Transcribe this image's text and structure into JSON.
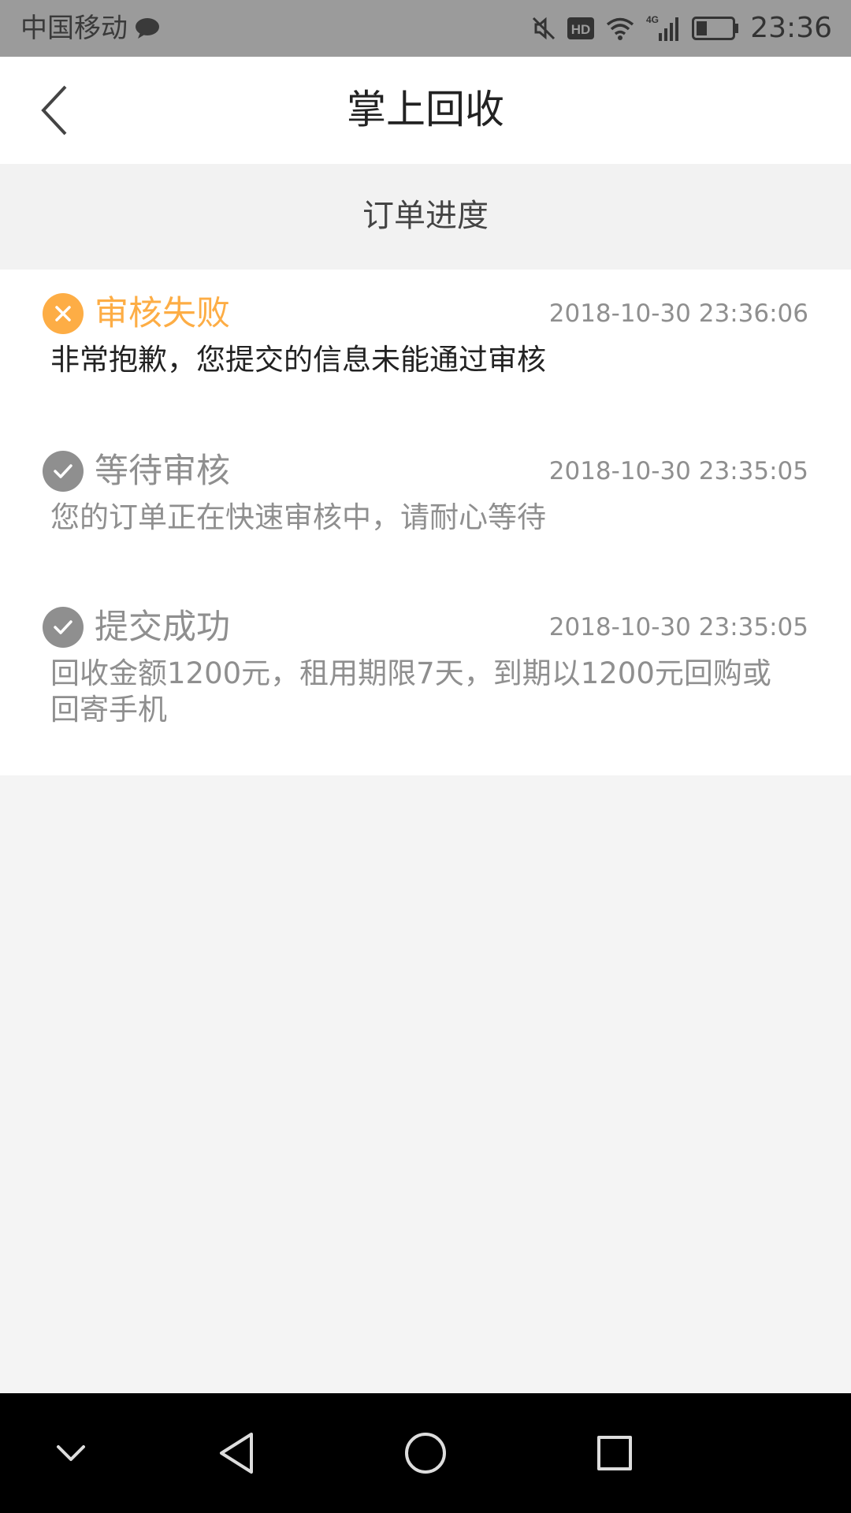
{
  "status_bar": {
    "carrier": "中国移动",
    "time": "23:36",
    "icons": [
      "chat-bubble-icon",
      "mute-icon",
      "hd-icon",
      "wifi-icon",
      "signal-4g-icon",
      "battery-icon"
    ]
  },
  "header": {
    "title": "掌上回收",
    "back_icon": "chevron-left-icon"
  },
  "section": {
    "title": "订单进度"
  },
  "timeline": [
    {
      "label": "审核失败",
      "time": "2018-10-30 23:36:06",
      "desc": "非常抱歉，您提交的信息未能通过审核",
      "state": "failed",
      "icon": "close-circle-icon",
      "color": "#fdad45"
    },
    {
      "label": "等待审核",
      "time": "2018-10-30 23:35:05",
      "desc": "您的订单正在快速审核中，请耐心等待",
      "state": "done",
      "icon": "check-circle-icon",
      "color": "#8f8f8f"
    },
    {
      "label": "提交成功",
      "time": "2018-10-30 23:35:05",
      "desc": "回收金额1200元，租用期限7天，到期以1200元回购或回寄手机",
      "state": "done",
      "icon": "check-circle-icon",
      "color": "#8f8f8f"
    }
  ],
  "system_nav": {
    "buttons": [
      "chevron-down-icon",
      "back-triangle-icon",
      "home-circle-icon",
      "recents-square-icon"
    ]
  },
  "colors": {
    "accent": "#fdad45",
    "muted": "#8f8f8f",
    "text": "#222222"
  }
}
